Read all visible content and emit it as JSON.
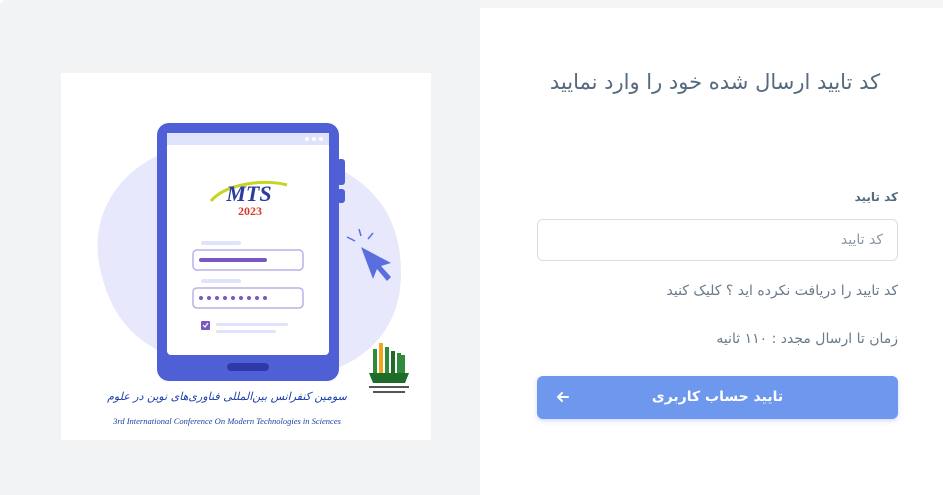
{
  "page": {
    "heading": "کد تایید ارسال شده خود را وارد نمایید"
  },
  "form": {
    "code_label": "کد تایید",
    "code_placeholder": "کد تایید",
    "code_value": "",
    "resend_link": "کد تایید را دریافت نکرده اید ؟ کلیک کنید",
    "timer_text": "زمان تا ارسال مجدد : ۱۱۰ ثانیه",
    "submit_label": "تایید حساب کاربری"
  },
  "illustration": {
    "mts_logo": "MTS",
    "mts_year": "2023",
    "conference_title_fa": "سومین کنفرانس بین‌المللی فناوری‌های نوین در علوم",
    "conference_title_en": "3rd International Conference On Modern Technologies in Sciences"
  },
  "colors": {
    "accent": "#6d98ed",
    "tablet": "#4f5fd6",
    "text": "#566a7f"
  },
  "icons": {
    "submit_arrow": "arrow-left-icon",
    "cursor": "mouse-pointer-icon"
  }
}
